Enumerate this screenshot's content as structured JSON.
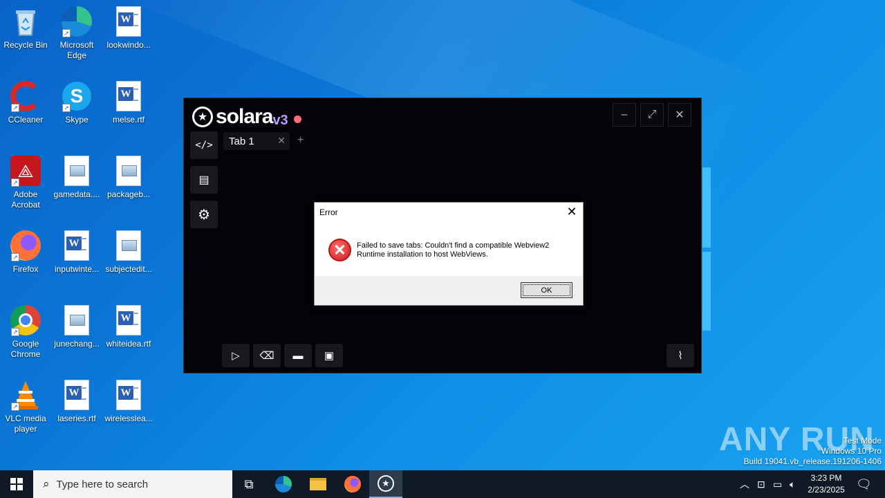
{
  "desktop": {
    "icons": [
      {
        "label": "Recycle Bin"
      },
      {
        "label": "Microsoft Edge"
      },
      {
        "label": "lookwindo..."
      },
      {
        "label": "CCleaner"
      },
      {
        "label": "Skype"
      },
      {
        "label": "melse.rtf"
      },
      {
        "label": "Adobe Acrobat"
      },
      {
        "label": "gamedata...."
      },
      {
        "label": "packageb..."
      },
      {
        "label": "Firefox"
      },
      {
        "label": "inputwinte..."
      },
      {
        "label": "subjectedit..."
      },
      {
        "label": "Google Chrome"
      },
      {
        "label": "junechang..."
      },
      {
        "label": "whiteidea.rtf"
      },
      {
        "label": "VLC media player"
      },
      {
        "label": "laseries.rtf"
      },
      {
        "label": "wirelesslea..."
      }
    ]
  },
  "solara": {
    "logo_name": "solara",
    "logo_version": "v3",
    "tab_label": "Tab 1",
    "tab_add": "+",
    "tab_close": "✕",
    "minimize": "–",
    "maximize": "⤢",
    "close": "✕"
  },
  "dialog": {
    "title": "Error",
    "message": "Failed to save tabs: Couldn't find a compatible Webview2 Runtime installation to host WebViews.",
    "ok_label": "OK",
    "close": "✕"
  },
  "watermark": "ANY RUN",
  "sysinfo": {
    "line1": "Test Mode",
    "line2": "Windows 10 Pro",
    "line3": "Build 19041.vb_release.191206-1406"
  },
  "taskbar": {
    "search_placeholder": "Type here to search",
    "time": "3:23 PM",
    "date": "2/23/2025"
  }
}
